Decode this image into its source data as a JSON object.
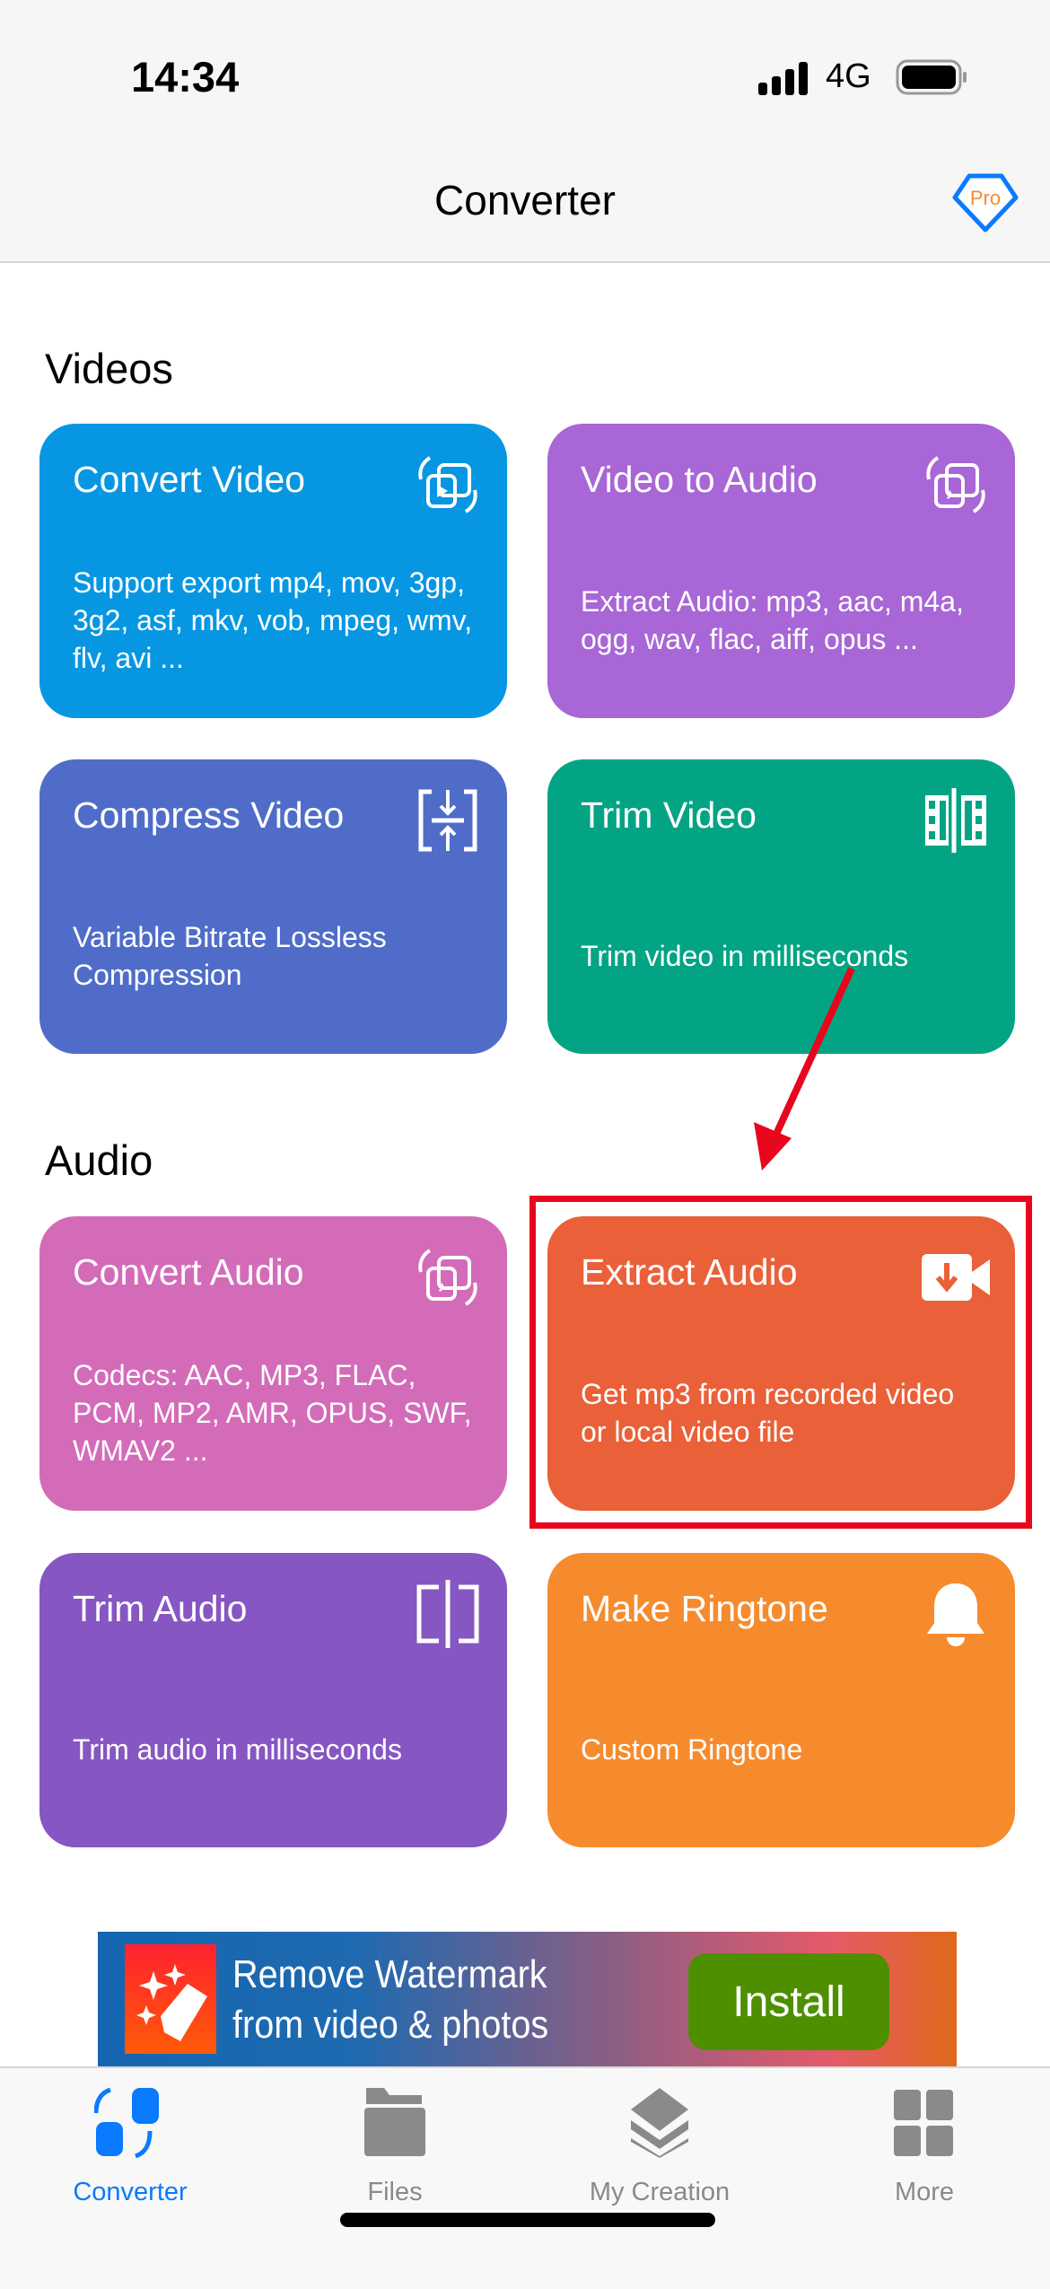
{
  "status": {
    "time": "14:34",
    "network": "4G"
  },
  "header": {
    "title": "Converter",
    "pro_badge": "Pro"
  },
  "sections": [
    {
      "title": "Videos"
    },
    {
      "title": "Audio"
    }
  ],
  "cards": [
    {
      "title": "Convert Video",
      "desc": "Support export mp4, mov, 3gp, 3g2, asf, mkv, vob, mpeg, wmv, flv, avi ...",
      "color": "#0797e2",
      "icon": "convert-video-icon"
    },
    {
      "title": "Video to Audio",
      "desc": "Extract Audio: mp3, aac, m4a, ogg, wav, flac, aiff, opus ...",
      "color": "#a866d6",
      "icon": "convert-audio-icon"
    },
    {
      "title": "Compress Video",
      "desc": "Variable Bitrate Lossless Compression",
      "color": "#4f6dc8",
      "icon": "compress-icon"
    },
    {
      "title": "Trim Video",
      "desc": "Trim video in milliseconds",
      "color": "#02a484",
      "icon": "film-trim-icon"
    },
    {
      "title": "Convert Audio",
      "desc": "Codecs: AAC, MP3, FLAC, PCM, MP2, AMR, OPUS, SWF, WMAV2 ...",
      "color": "#d46bb9",
      "icon": "convert-audio-icon"
    },
    {
      "title": "Extract Audio",
      "desc": "Get mp3 from recorded video or local video file",
      "color": "#ea6038",
      "icon": "video-download-icon"
    },
    {
      "title": "Trim Audio",
      "desc": "Trim audio in milliseconds",
      "color": "#8656c3",
      "icon": "trim-icon"
    },
    {
      "title": "Make Ringtone",
      "desc": "Custom Ringtone",
      "color": "#f68b2e",
      "icon": "bell-icon"
    }
  ],
  "ad": {
    "line1": "Remove Watermark",
    "line2": "from video & photos",
    "button": "Install"
  },
  "tabs": [
    {
      "label": "Converter",
      "active": true
    },
    {
      "label": "Files"
    },
    {
      "label": "My Creation"
    },
    {
      "label": "More"
    }
  ],
  "colors": {
    "accent": "#0a7aff",
    "annotation": "#e8061c"
  }
}
